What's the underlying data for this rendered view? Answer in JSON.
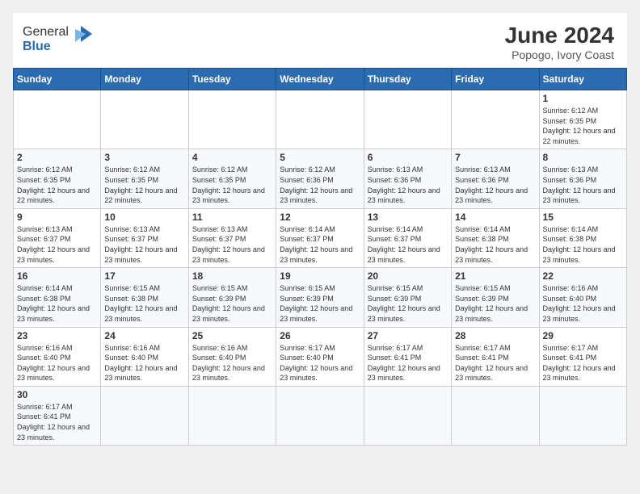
{
  "header": {
    "logo_general": "General",
    "logo_blue": "Blue",
    "month_title": "June 2024",
    "location": "Popogo, Ivory Coast"
  },
  "weekdays": [
    "Sunday",
    "Monday",
    "Tuesday",
    "Wednesday",
    "Thursday",
    "Friday",
    "Saturday"
  ],
  "weeks": [
    [
      {
        "day": "",
        "info": ""
      },
      {
        "day": "",
        "info": ""
      },
      {
        "day": "",
        "info": ""
      },
      {
        "day": "",
        "info": ""
      },
      {
        "day": "",
        "info": ""
      },
      {
        "day": "",
        "info": ""
      },
      {
        "day": "1",
        "info": "Sunrise: 6:12 AM\nSunset: 6:35 PM\nDaylight: 12 hours and 22 minutes."
      }
    ],
    [
      {
        "day": "2",
        "info": "Sunrise: 6:12 AM\nSunset: 6:35 PM\nDaylight: 12 hours and 22 minutes."
      },
      {
        "day": "3",
        "info": "Sunrise: 6:12 AM\nSunset: 6:35 PM\nDaylight: 12 hours and 22 minutes."
      },
      {
        "day": "4",
        "info": "Sunrise: 6:12 AM\nSunset: 6:35 PM\nDaylight: 12 hours and 23 minutes."
      },
      {
        "day": "5",
        "info": "Sunrise: 6:12 AM\nSunset: 6:36 PM\nDaylight: 12 hours and 23 minutes."
      },
      {
        "day": "6",
        "info": "Sunrise: 6:13 AM\nSunset: 6:36 PM\nDaylight: 12 hours and 23 minutes."
      },
      {
        "day": "7",
        "info": "Sunrise: 6:13 AM\nSunset: 6:36 PM\nDaylight: 12 hours and 23 minutes."
      },
      {
        "day": "8",
        "info": "Sunrise: 6:13 AM\nSunset: 6:36 PM\nDaylight: 12 hours and 23 minutes."
      }
    ],
    [
      {
        "day": "9",
        "info": "Sunrise: 6:13 AM\nSunset: 6:37 PM\nDaylight: 12 hours and 23 minutes."
      },
      {
        "day": "10",
        "info": "Sunrise: 6:13 AM\nSunset: 6:37 PM\nDaylight: 12 hours and 23 minutes."
      },
      {
        "day": "11",
        "info": "Sunrise: 6:13 AM\nSunset: 6:37 PM\nDaylight: 12 hours and 23 minutes."
      },
      {
        "day": "12",
        "info": "Sunrise: 6:14 AM\nSunset: 6:37 PM\nDaylight: 12 hours and 23 minutes."
      },
      {
        "day": "13",
        "info": "Sunrise: 6:14 AM\nSunset: 6:37 PM\nDaylight: 12 hours and 23 minutes."
      },
      {
        "day": "14",
        "info": "Sunrise: 6:14 AM\nSunset: 6:38 PM\nDaylight: 12 hours and 23 minutes."
      },
      {
        "day": "15",
        "info": "Sunrise: 6:14 AM\nSunset: 6:38 PM\nDaylight: 12 hours and 23 minutes."
      }
    ],
    [
      {
        "day": "16",
        "info": "Sunrise: 6:14 AM\nSunset: 6:38 PM\nDaylight: 12 hours and 23 minutes."
      },
      {
        "day": "17",
        "info": "Sunrise: 6:15 AM\nSunset: 6:38 PM\nDaylight: 12 hours and 23 minutes."
      },
      {
        "day": "18",
        "info": "Sunrise: 6:15 AM\nSunset: 6:39 PM\nDaylight: 12 hours and 23 minutes."
      },
      {
        "day": "19",
        "info": "Sunrise: 6:15 AM\nSunset: 6:39 PM\nDaylight: 12 hours and 23 minutes."
      },
      {
        "day": "20",
        "info": "Sunrise: 6:15 AM\nSunset: 6:39 PM\nDaylight: 12 hours and 23 minutes."
      },
      {
        "day": "21",
        "info": "Sunrise: 6:15 AM\nSunset: 6:39 PM\nDaylight: 12 hours and 23 minutes."
      },
      {
        "day": "22",
        "info": "Sunrise: 6:16 AM\nSunset: 6:40 PM\nDaylight: 12 hours and 23 minutes."
      }
    ],
    [
      {
        "day": "23",
        "info": "Sunrise: 6:16 AM\nSunset: 6:40 PM\nDaylight: 12 hours and 23 minutes."
      },
      {
        "day": "24",
        "info": "Sunrise: 6:16 AM\nSunset: 6:40 PM\nDaylight: 12 hours and 23 minutes."
      },
      {
        "day": "25",
        "info": "Sunrise: 6:16 AM\nSunset: 6:40 PM\nDaylight: 12 hours and 23 minutes."
      },
      {
        "day": "26",
        "info": "Sunrise: 6:17 AM\nSunset: 6:40 PM\nDaylight: 12 hours and 23 minutes."
      },
      {
        "day": "27",
        "info": "Sunrise: 6:17 AM\nSunset: 6:41 PM\nDaylight: 12 hours and 23 minutes."
      },
      {
        "day": "28",
        "info": "Sunrise: 6:17 AM\nSunset: 6:41 PM\nDaylight: 12 hours and 23 minutes."
      },
      {
        "day": "29",
        "info": "Sunrise: 6:17 AM\nSunset: 6:41 PM\nDaylight: 12 hours and 23 minutes."
      }
    ],
    [
      {
        "day": "30",
        "info": "Sunrise: 6:17 AM\nSunset: 6:41 PM\nDaylight: 12 hours and 23 minutes."
      },
      {
        "day": "",
        "info": ""
      },
      {
        "day": "",
        "info": ""
      },
      {
        "day": "",
        "info": ""
      },
      {
        "day": "",
        "info": ""
      },
      {
        "day": "",
        "info": ""
      },
      {
        "day": "",
        "info": ""
      }
    ]
  ]
}
